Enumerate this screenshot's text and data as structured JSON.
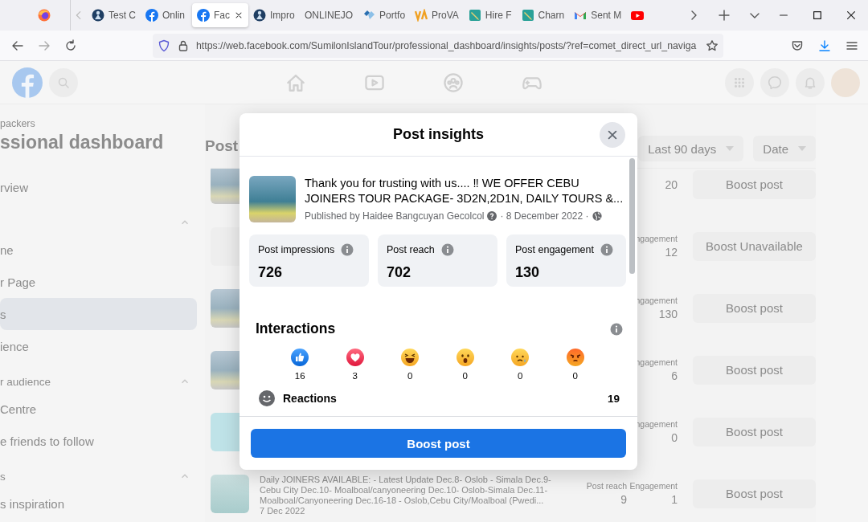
{
  "browser": {
    "tabs": [
      {
        "kind": "figure",
        "label": "Test C",
        "selected": false
      },
      {
        "kind": "facebook",
        "label": "Onlin",
        "selected": false
      },
      {
        "kind": "facebook",
        "label": "Fac",
        "selected": true
      },
      {
        "kind": "figure",
        "label": "Impro",
        "selected": false
      },
      {
        "kind": "plain",
        "label": "ONLINEJO",
        "selected": false
      },
      {
        "kind": "hearts",
        "label": "Portfo",
        "selected": false
      },
      {
        "kind": "va",
        "label": "ProVA",
        "selected": false
      },
      {
        "kind": "pencil",
        "label": "Hire F",
        "selected": false
      },
      {
        "kind": "pencil",
        "label": "Charn",
        "selected": false
      },
      {
        "kind": "mail",
        "label": "Sent M",
        "selected": false
      },
      {
        "kind": "play",
        "selected": false
      }
    ],
    "url": "https://web.facebook.com/SumilonIslandTour/professional_dashboard/insights/posts/?ref=comet_direct_url_naviga"
  },
  "sidebar": {
    "page_name": "packers",
    "title": "ssional dashboard",
    "top_items": [
      {
        "label": "rview",
        "selected": false
      }
    ],
    "sections": [
      {
        "expanded": true,
        "items": [
          {
            "label": "ne",
            "selected": false
          },
          {
            "label": "r Page",
            "selected": false
          },
          {
            "label": "s",
            "selected": true
          },
          {
            "label": "ience",
            "selected": false
          }
        ]
      },
      {
        "label": "r audience",
        "expanded": true,
        "items": [
          {
            "label": "Centre",
            "selected": false
          },
          {
            "label": "e friends to follow",
            "selected": false
          }
        ]
      },
      {
        "label": "s",
        "expanded": true,
        "items": [
          {
            "label": "s inspiration",
            "selected": false
          }
        ]
      }
    ]
  },
  "main": {
    "title": "Post",
    "filters": [
      {
        "label": "Last 90 days"
      },
      {
        "label": "Date"
      }
    ],
    "posts": [
      {
        "kind": "photo",
        "engagement": "20",
        "button": "Boost post"
      },
      {
        "kind": "text",
        "engagement_label": "ngagement",
        "engagement": "12",
        "button": "Boost Unavailable"
      },
      {
        "kind": "photo",
        "engagement_label": "ngagement",
        "engagement": "130",
        "button": "Boost post"
      },
      {
        "kind": "photo",
        "engagement_label": "ngagement",
        "engagement": "6",
        "button": "Boost post"
      },
      {
        "kind": "teal",
        "engagement_label": "ngagement",
        "engagement": "0",
        "button": "Boost post"
      },
      {
        "kind": "water",
        "text": "Daily JOINERS AVAILABLE: - Latest Update Dec.8- Oslob - Simala Dec.9- Cebu City Dec.10- Moalboal/canyoneering Dec.10- Oslob-Simala Dec.11- Moalboal/Canyoneering Dec.16-18 - Oslob,Cebu City/Moalboal (Pwedi...",
        "date": "7 Dec 2022",
        "reach_label": "Post reach",
        "reach": "9",
        "engagement_label": "Engagement",
        "engagement": "1",
        "button": "Boost post"
      }
    ]
  },
  "modal": {
    "title": "Post insights",
    "post": {
      "text": "Thank you for trusting with us.... ‼ WE OFFER CEBU JOINERS TOUR PACKAGE- 3D2N,2D1N, DAILY TOURS &...",
      "author": "Published by Haidee Bangcuyan Gecolcol",
      "date": "· 8 December 2022 ·"
    },
    "metrics": [
      {
        "label": "Post impressions",
        "value": "726"
      },
      {
        "label": "Post reach",
        "value": "702"
      },
      {
        "label": "Post engagement",
        "value": "130"
      }
    ],
    "interactions": {
      "title": "Interactions",
      "reactions": [
        {
          "kind": "like",
          "count": "16"
        },
        {
          "kind": "love",
          "count": "3"
        },
        {
          "kind": "haha",
          "count": "0"
        },
        {
          "kind": "wow",
          "count": "0"
        },
        {
          "kind": "sad",
          "count": "0"
        },
        {
          "kind": "angry",
          "count": "0"
        }
      ],
      "summary_label": "Reactions",
      "summary_value": "19"
    },
    "button": "Boost post"
  }
}
